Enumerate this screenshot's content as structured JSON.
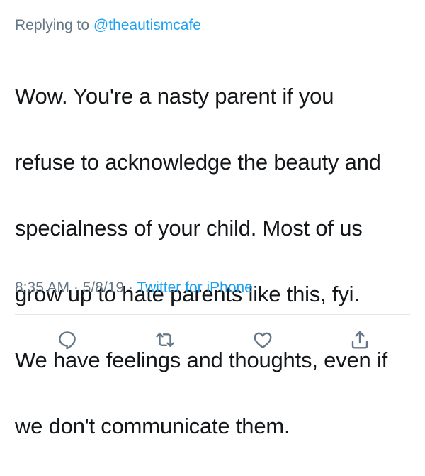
{
  "reply": {
    "prefix": "Replying to",
    "handle": "@theautismcafe"
  },
  "tweet": {
    "text_lines": [
      "Wow. You're a nasty parent if you",
      "refuse to acknowledge the beauty and",
      "specialness of your child. Most of us",
      "grow up to hate parents like this, fyi.",
      "We have feelings and thoughts, even if",
      "we don't communicate them."
    ]
  },
  "meta": {
    "time": "8:35 AM",
    "separator": "·",
    "date": "5/8/19",
    "source": "Twitter for iPhone"
  },
  "actions": {
    "icons": [
      "reply-icon",
      "retweet-icon",
      "like-icon",
      "share-icon"
    ]
  },
  "colors": {
    "text": "#14171a",
    "secondary": "#657786",
    "accent": "#1da1f2",
    "divider": "#e1e8ed"
  }
}
